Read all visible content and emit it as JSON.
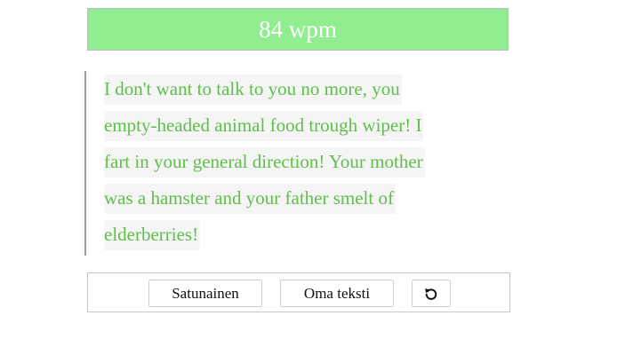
{
  "header": {
    "wpm_text": "84 wpm",
    "accent_color": "#90ee90"
  },
  "text": {
    "lines": [
      "I don't want to talk to you no more, you",
      "empty-headed animal food trough wiper! I",
      "fart in your general direction! Your mother",
      "was a hamster and your father smelt of",
      "elderberries!"
    ],
    "color": "#5fbf4a"
  },
  "controls": {
    "random_label": "Satunainen",
    "own_text_label": "Oma teksti",
    "reset_icon": "rotate-ccw-icon"
  }
}
